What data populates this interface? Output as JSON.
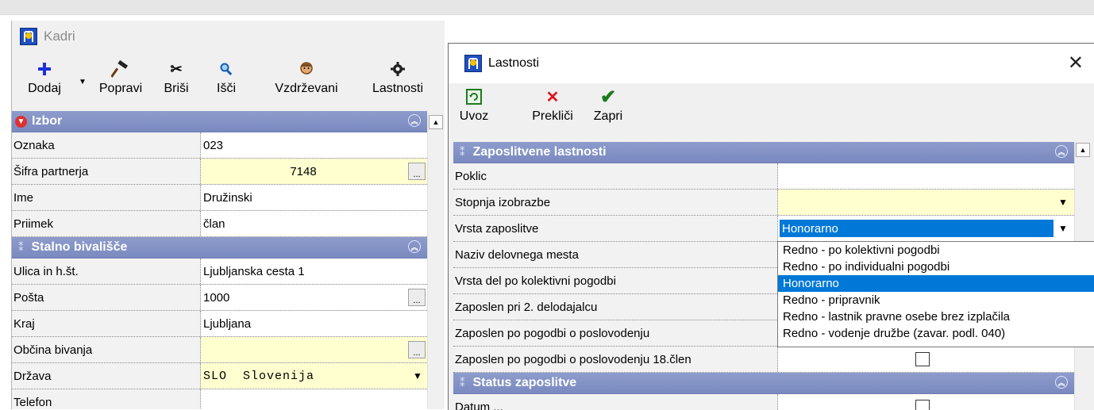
{
  "main_window": {
    "title": "Kadri",
    "toolbar": [
      {
        "label": "Dodaj",
        "icon": "plus-icon"
      },
      {
        "label": "Popravi",
        "icon": "hammer-icon"
      },
      {
        "label": "Briši",
        "icon": "scissors-icon"
      },
      {
        "label": "Išči",
        "icon": "magnifier-icon"
      },
      {
        "label": "Vzdrževani",
        "icon": "person-icon"
      },
      {
        "label": "Lastnosti",
        "icon": "properties-icon"
      }
    ],
    "sections": [
      {
        "title": "Izbor",
        "rows": [
          {
            "label": "Oznaka",
            "value": "023"
          },
          {
            "label": "Šifra partnerja",
            "value": "7148"
          },
          {
            "label": "Ime",
            "value": "Družinski"
          },
          {
            "label": "Priimek",
            "value": "član"
          }
        ]
      },
      {
        "title": "Stalno bivališče",
        "rows": [
          {
            "label": "Ulica in h.št.",
            "value": "Ljubljanska cesta 1"
          },
          {
            "label": "Pošta",
            "value": "1000"
          },
          {
            "label": "Kraj",
            "value": "Ljubljana"
          },
          {
            "label": "Občina bivanja",
            "value": ""
          },
          {
            "label": "Država",
            "value": "SLO  Slovenija"
          },
          {
            "label": "Telefon",
            "value": ""
          }
        ]
      }
    ]
  },
  "dialog": {
    "title": "Lastnosti",
    "close": "✕",
    "toolbar": [
      {
        "label": "Uvoz",
        "icon": "import-icon"
      },
      {
        "label": "Prekliči",
        "icon": "cancel-icon"
      },
      {
        "label": "Zapri",
        "icon": "check-icon"
      }
    ],
    "sections": [
      {
        "title": "Zaposlitvene lastnosti",
        "rows": [
          {
            "label": "Poklic",
            "value": ""
          },
          {
            "label": "Stopnja izobrazbe",
            "value": ""
          },
          {
            "label": "Vrsta zaposlitve",
            "value": "Honorarno"
          },
          {
            "label": "Naziv delovnega mesta",
            "value": ""
          },
          {
            "label": "Vrsta del po kolektivni pogodbi",
            "value": ""
          },
          {
            "label": "Zaposlen pri 2. delodajalcu",
            "value": ""
          },
          {
            "label": "Zaposlen po pogodbi o poslovodenju",
            "value": ""
          },
          {
            "label": "Zaposlen po pogodbi o poslovodenju 18.člen",
            "value": ""
          }
        ]
      },
      {
        "title": "Status zaposlitve",
        "rows": [
          {
            "label": "Datum ...",
            "value": ""
          }
        ]
      }
    ],
    "dropdown_options": [
      "Redno - po kolektivni pogodbi",
      "Redno - po individualni pogodbi",
      "Honorarno",
      "Redno - pripravnik",
      "Redno - lastnik pravne osebe brez izplačila",
      "Redno - vodenje družbe (zavar. podl. 040)"
    ],
    "selected_option": "Honorarno"
  },
  "colors": {
    "section_header": "#7f8ec4",
    "selection": "#0078d7",
    "required_field": "#ffffd0"
  }
}
